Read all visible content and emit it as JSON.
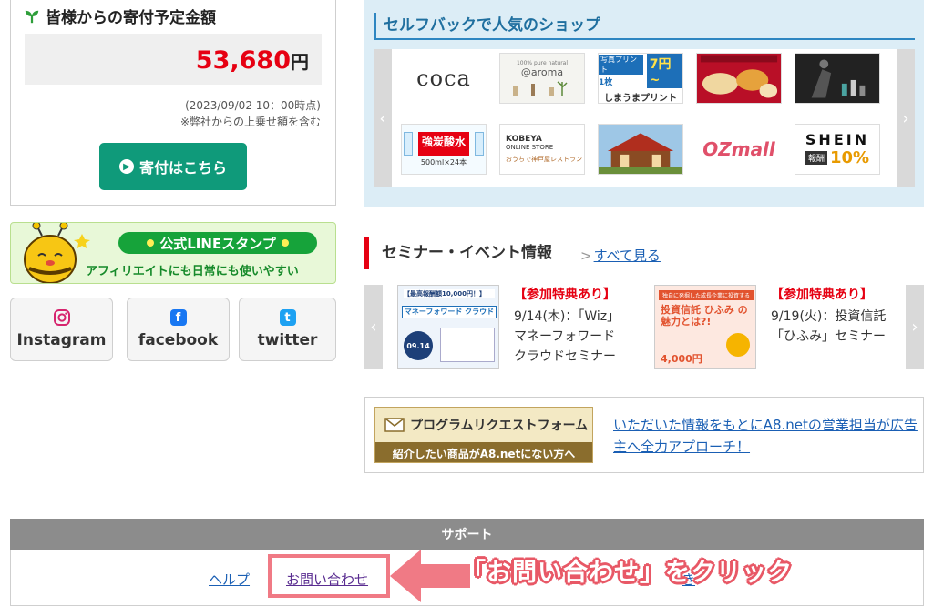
{
  "donation": {
    "title": "皆様からの寄付予定金額",
    "amount": "53,680",
    "unit": "円",
    "as_of": "(2023/09/02 10：00時点)",
    "note": "※弊社からの上乗せ額を含む",
    "button_label": "寄付はこちら"
  },
  "line_banner": {
    "title": "公式LINEスタンプ",
    "subtitle": "アフィリエイトにも日常にも使いやすい"
  },
  "social": [
    {
      "label": "Instagram",
      "icon": "instagram-icon"
    },
    {
      "label": "facebook",
      "icon": "facebook-icon",
      "glyph": "f"
    },
    {
      "label": "twitter",
      "icon": "twitter-icon",
      "glyph": "t"
    }
  ],
  "shops": {
    "heading": "セルフバックで人気のショップ",
    "tiles": {
      "coca": "coca",
      "aroma": "@aroma",
      "aroma_small": "100% pure natural",
      "print_a": "写真プリント",
      "print_b": "1枚",
      "print_price": "7円~",
      "print_name": "しまうまプリント",
      "soda": "強炭酸水",
      "soda_sub": "500ml×24本",
      "kobeya": "KOBEYA",
      "kobeya_sub": "ONLINE STORE",
      "kobeya_sub2": "おうちで神戸屋レストラン",
      "ozmall": "OZmall",
      "shein": "SHEIN",
      "shein_a": "報酬",
      "shein_b": "10%"
    }
  },
  "seminar": {
    "heading": "セミナー・イベント情報",
    "see_all": "すべて見る",
    "items": [
      {
        "badge": "【参加特典あり】",
        "desc": "9/14(木)：「Wiz」マネーフォワード クラウドセミナー",
        "thumb_top": "【最高報酬額10,000円！】",
        "thumb_title": "マネーフォワード クラウド",
        "thumb_date": "09.14"
      },
      {
        "badge": "【参加特典あり】",
        "desc": "9/19(火)：投資信託「ひふみ」セミナー",
        "thumb_top": "独自に発掘した成長企業に投資する",
        "thumb_title": "投資信託 ひふみ の魅力とは?!",
        "thumb_price": "4,000円"
      }
    ]
  },
  "program_request": {
    "banner_title": "プログラムリクエストフォーム",
    "banner_sub": "紹介したい商品がA8.netにない方へ",
    "link_text": "いただいた情報をもとにA8.netの営業担当が広告主へ全力アプローチ！"
  },
  "support": {
    "heading": "サポート",
    "links": [
      "ヘルプ",
      "お問い合わせ"
    ],
    "partial_a": "紹",
    "partial_b": "き"
  },
  "annotation": {
    "caption": "「お問い合わせ」をクリック"
  },
  "colors": {
    "accent_green": "#0f9a7a",
    "amount_red": "#e60012",
    "link_blue": "#1a5fb4",
    "highlight_pink": "#f07a85"
  }
}
